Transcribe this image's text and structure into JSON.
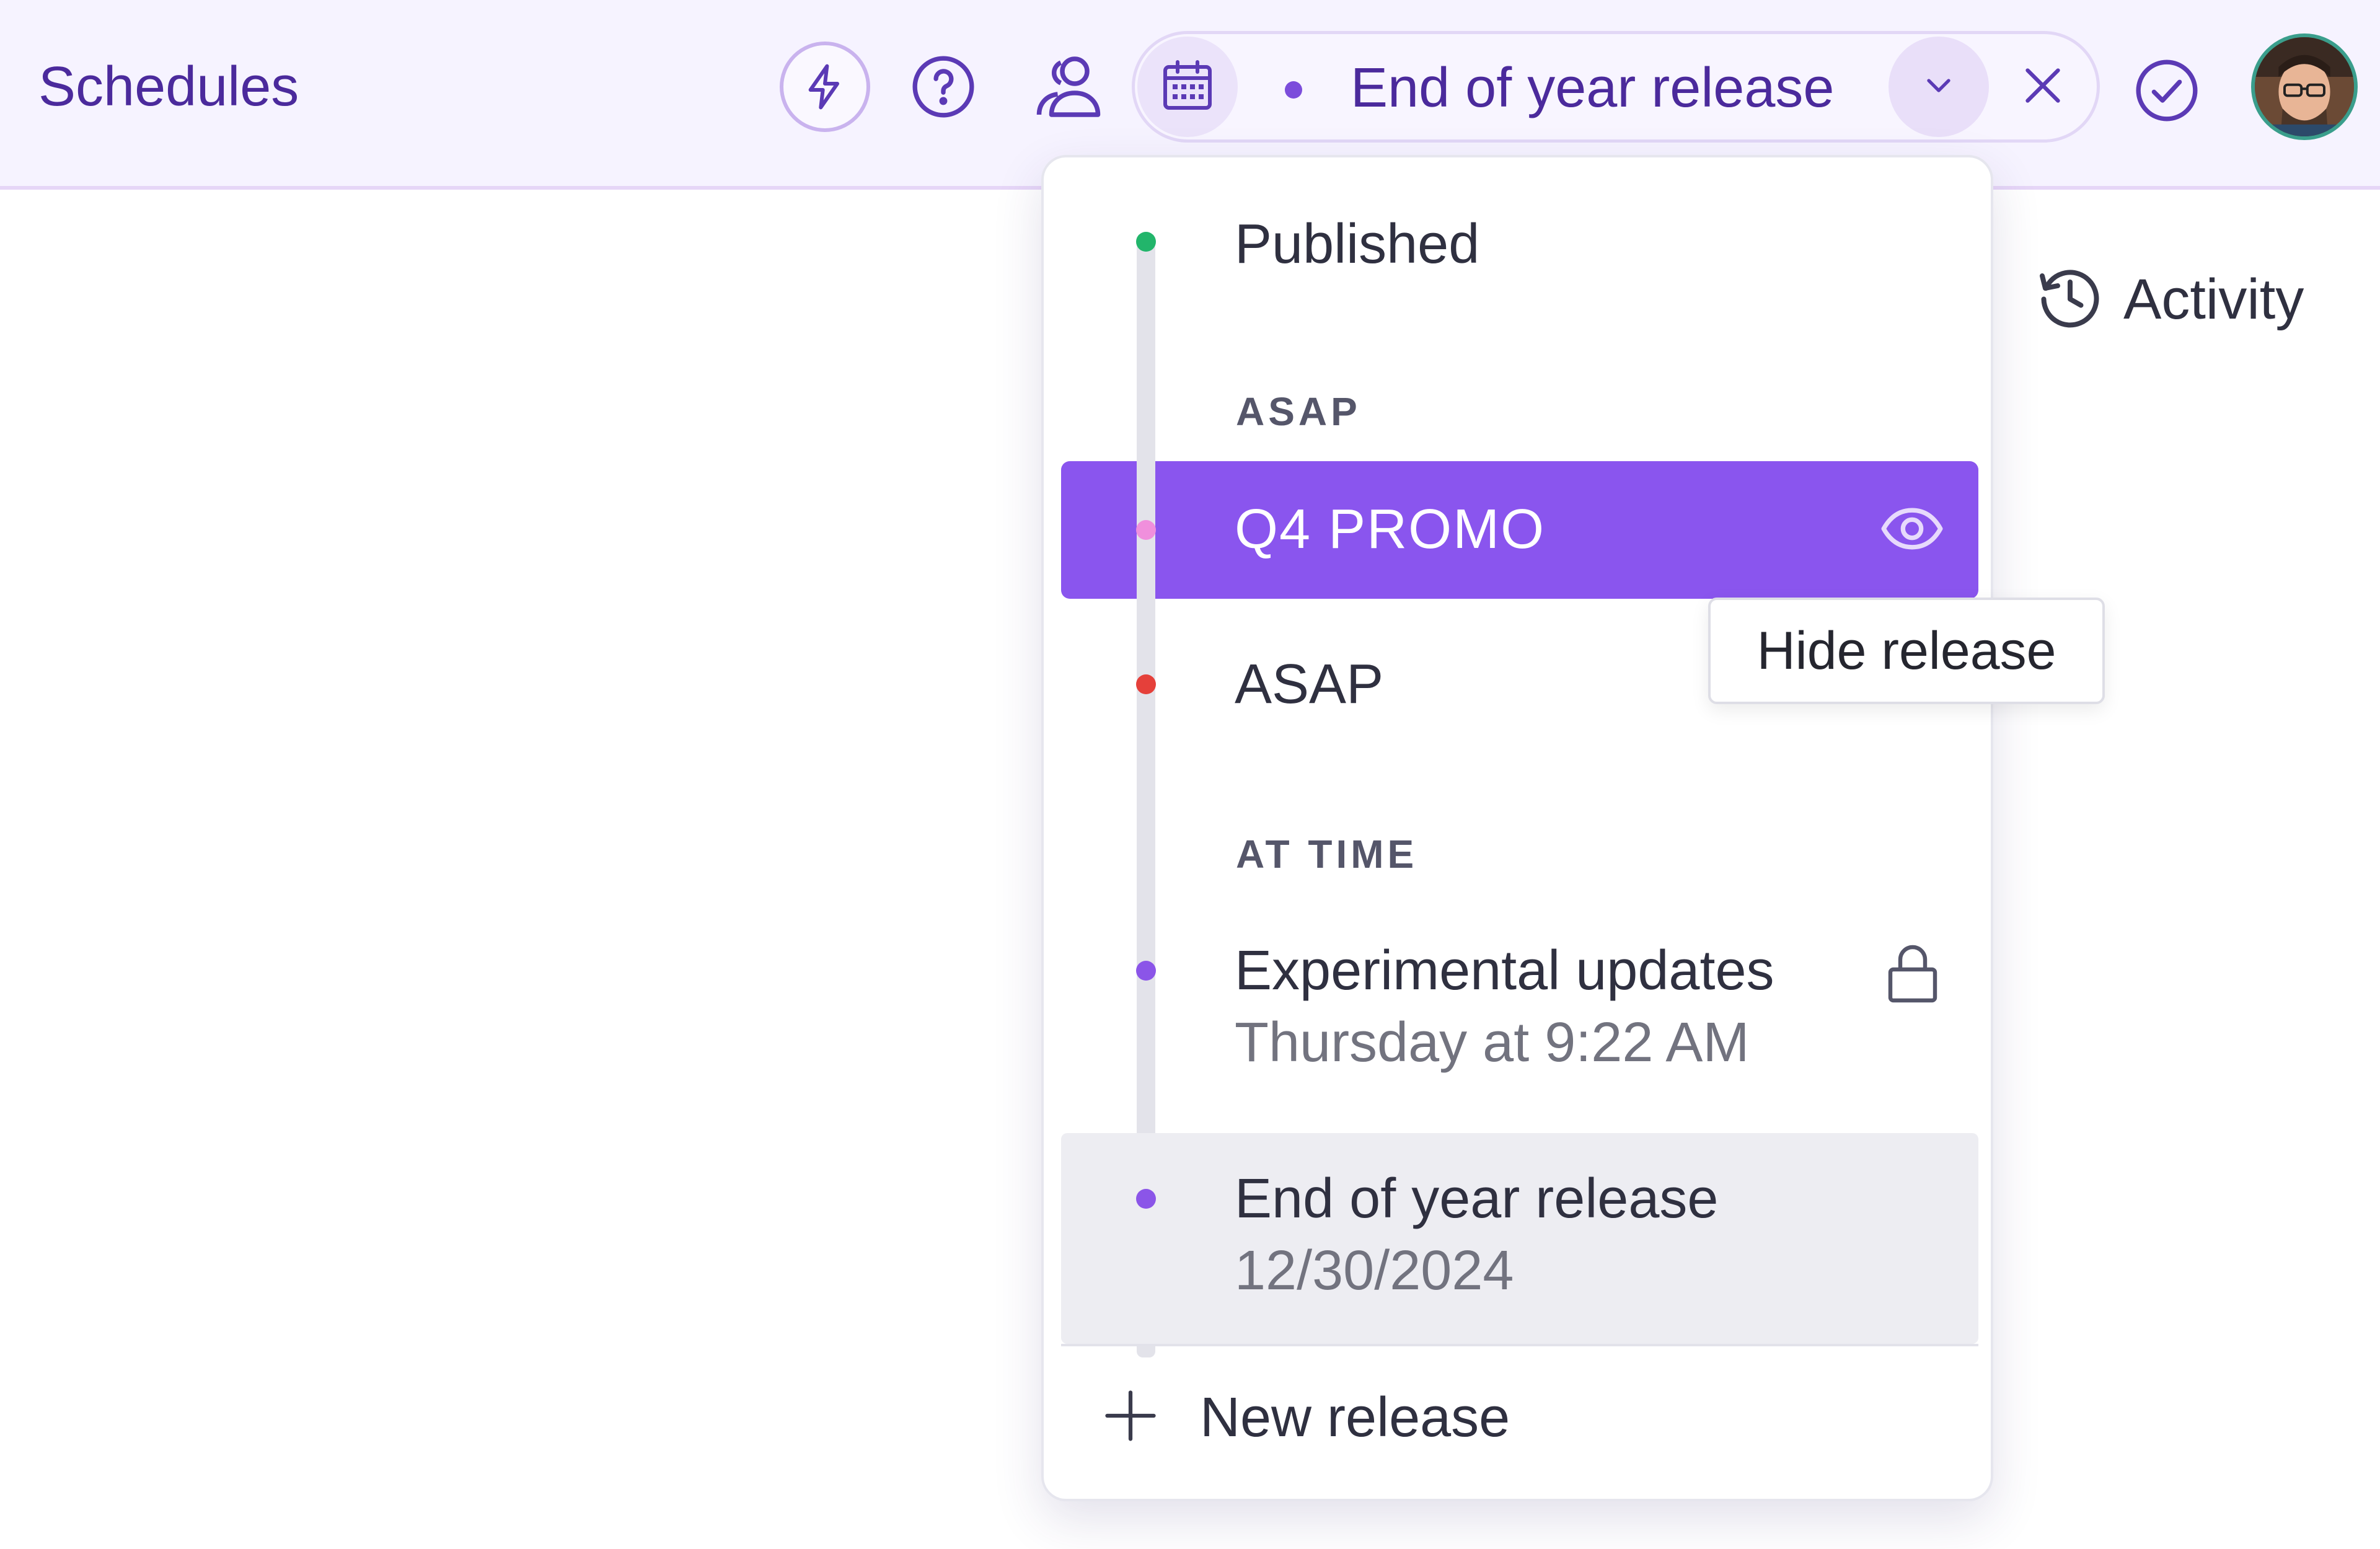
{
  "header": {
    "title": "Schedules",
    "current_release": "End of year release"
  },
  "activity": {
    "label": "Activity"
  },
  "releases": {
    "published": {
      "label": "Published",
      "dot_color": "#22b56b"
    },
    "asap_section": "ASAP",
    "asap_items": [
      {
        "label": "Q4 PROMO",
        "dot_color": "#f08fdc",
        "selected": true
      },
      {
        "label": "ASAP",
        "dot_color": "#e5403a"
      }
    ],
    "at_time_section": "AT TIME",
    "at_time_items": [
      {
        "label": "Experimental updates",
        "sub": "Thursday at 9:22 AM",
        "dot_color": "#8b55e8",
        "locked": true
      },
      {
        "label": "End of year release",
        "sub": "12/30/2024",
        "dot_color": "#8b55e8",
        "current": true
      }
    ],
    "new_release_label": "New release"
  },
  "tooltip": {
    "text": "Hide release"
  },
  "colors": {
    "accent": "#8a55ee",
    "brand_text": "#4b2a9c",
    "header_bg": "#f6f3ff"
  },
  "icons": [
    "bolt-icon",
    "help-icon",
    "people-icon",
    "calendar-icon",
    "chevron-down-icon",
    "close-icon",
    "check-circle-icon",
    "history-icon",
    "eye-icon",
    "lock-icon",
    "plus-icon"
  ]
}
